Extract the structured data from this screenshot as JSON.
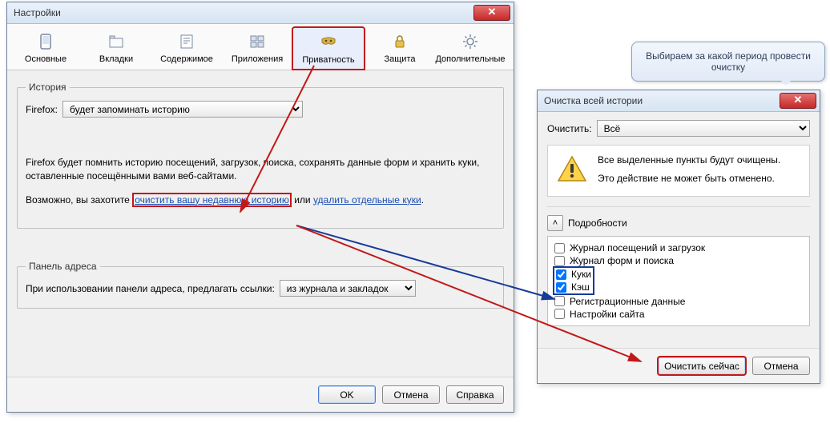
{
  "settings": {
    "title": "Настройки",
    "tabs": [
      {
        "label": "Основные"
      },
      {
        "label": "Вкладки"
      },
      {
        "label": "Содержимое"
      },
      {
        "label": "Приложения"
      },
      {
        "label": "Приватность"
      },
      {
        "label": "Защита"
      },
      {
        "label": "Дополнительные"
      }
    ],
    "history": {
      "legend": "История",
      "label": "Firefox:",
      "combo": "будет запоминать историю",
      "desc1": "Firefox будет помнить историю посещений, загрузок, поиска, сохранять данные форм и хранить куки, оставленные посещёнными вами веб-сайтами.",
      "desc2_prefix": "Возможно, вы захотите ",
      "link1": "очистить вашу недавнюю историю",
      "desc2_mid": " или ",
      "link2": "удалить отдельные куки",
      "desc2_suffix": "."
    },
    "addressbar": {
      "legend": "Панель адреса",
      "label": "При использовании панели адреса, предлагать ссылки:",
      "combo": "из журнала и закладок"
    },
    "buttons": {
      "ok": "OK",
      "cancel": "Отмена",
      "help": "Справка"
    }
  },
  "clear": {
    "title": "Очистка всей истории",
    "range_label": "Очистить:",
    "range_value": "Всё",
    "warning1": "Все выделенные пункты будут очищены.",
    "warning2": "Это действие не может быть отменено.",
    "details_label": "Подробности",
    "items": [
      {
        "label": "Журнал посещений и загрузок",
        "checked": false
      },
      {
        "label": "Журнал форм и поиска",
        "checked": false
      },
      {
        "label": "Куки",
        "checked": true
      },
      {
        "label": "Кэш",
        "checked": true
      },
      {
        "label": "Регистрационные данные",
        "checked": false
      },
      {
        "label": "Настройки сайта",
        "checked": false
      }
    ],
    "buttons": {
      "clear_now": "Очистить сейчас",
      "cancel": "Отмена"
    }
  },
  "tooltip": "Выбираем за какой период провести очистку"
}
